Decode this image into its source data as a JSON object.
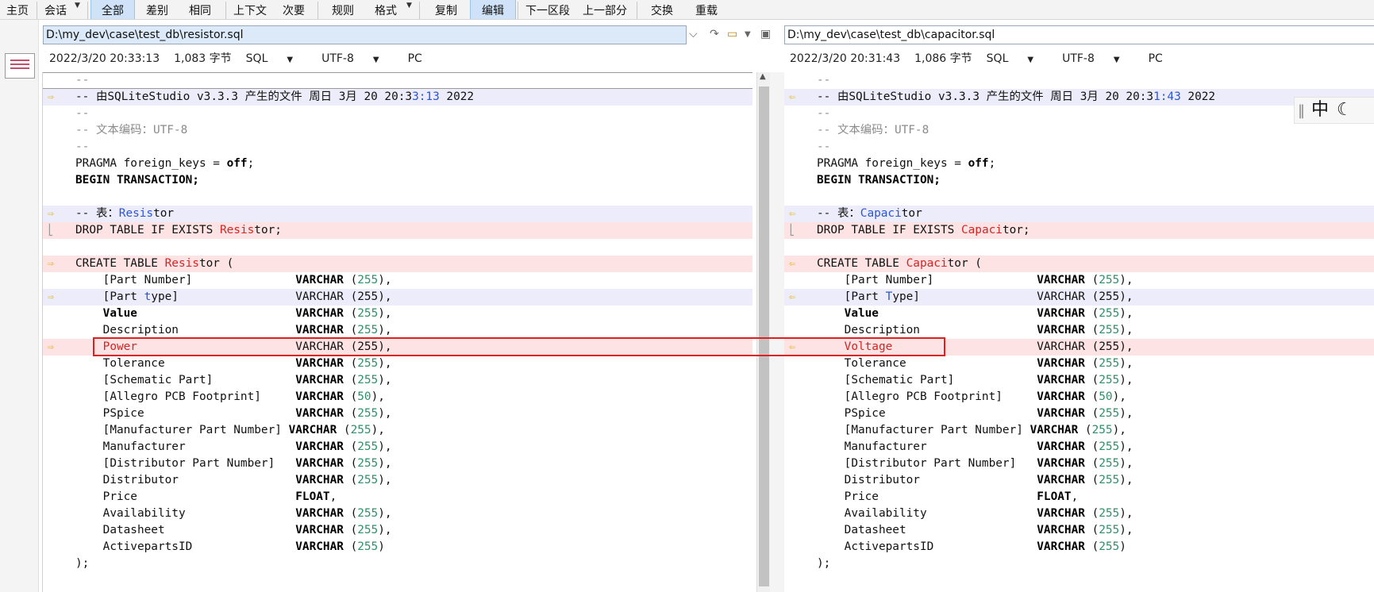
{
  "toolbar": {
    "items": [
      "主页",
      "会话",
      "全部",
      "差别",
      "相同",
      "上下文",
      "次要",
      "规则",
      "格式",
      "复制",
      "编辑",
      "下一区段",
      "上一部分",
      "交换",
      "重载"
    ]
  },
  "left": {
    "path": "D:\\my_dev\\case\\test_db\\resistor.sql",
    "info": {
      "datetime": "2022/3/20 20:33:13",
      "size": "1,083 字节",
      "format": "SQL",
      "encoding": "UTF-8",
      "eol": "PC"
    },
    "lines": [
      {
        "t": "--",
        "cls": "cmt",
        "bg": "cur"
      },
      {
        "parts": [
          [
            "-- 由SQLiteStudio v3.3.3 产生的文件 周日 3月 20 20:3",
            ""
          ],
          [
            "3:13",
            "chg"
          ],
          [
            " 2022",
            ""
          ]
        ],
        "bg": "mod",
        "mark": "arrow"
      },
      {
        "t": "--",
        "cls": "cmt"
      },
      {
        "t": "-- 文本编码：UTF-8",
        "cls": "cmt"
      },
      {
        "t": "--",
        "cls": "cmt"
      },
      {
        "parts": [
          [
            "PRAGMA foreign_keys = ",
            ""
          ],
          [
            "off",
            "kw"
          ],
          [
            ";",
            ""
          ]
        ]
      },
      {
        "parts": [
          [
            "BEGIN TRANSACTION;",
            "kw"
          ]
        ]
      },
      {
        "t": ""
      },
      {
        "parts": [
          [
            "-- 表：",
            ""
          ],
          [
            "Resis",
            "chg"
          ],
          [
            "tor",
            ""
          ]
        ],
        "bg": "mod",
        "mark": "arrow"
      },
      {
        "parts": [
          [
            "DROP TABLE IF EXISTS ",
            ""
          ],
          [
            "Resis",
            "del-t"
          ],
          [
            "tor;",
            ""
          ]
        ],
        "bg": "del",
        "mark": "bar"
      },
      {
        "t": ""
      },
      {
        "parts": [
          [
            "CREATE TABLE ",
            ""
          ],
          [
            "Resis",
            "del-t"
          ],
          [
            "tor (",
            ""
          ]
        ],
        "bg": "del",
        "mark": "arrow"
      },
      {
        "parts": [
          [
            "    [Part Number]               ",
            ""
          ],
          [
            "VARCHAR",
            "kw"
          ],
          [
            " (",
            ""
          ],
          [
            "255",
            "num"
          ],
          [
            "),",
            ""
          ]
        ]
      },
      {
        "parts": [
          [
            "    [Part ",
            ""
          ],
          [
            "t",
            "chg"
          ],
          [
            "ype]                 VARCHAR (255),",
            ""
          ]
        ],
        "bg": "mod",
        "mark": "arrow"
      },
      {
        "parts": [
          [
            "    ",
            ""
          ],
          [
            "Value",
            "kw"
          ],
          [
            "                       ",
            ""
          ],
          [
            "VARCHAR",
            "kw"
          ],
          [
            " (",
            ""
          ],
          [
            "255",
            "num"
          ],
          [
            "),",
            ""
          ]
        ]
      },
      {
        "parts": [
          [
            "    Description                 ",
            ""
          ],
          [
            "VARCHAR",
            "kw"
          ],
          [
            " (",
            ""
          ],
          [
            "255",
            "num"
          ],
          [
            "),",
            ""
          ]
        ]
      },
      {
        "parts": [
          [
            "    ",
            ""
          ],
          [
            "Power",
            "del-t"
          ],
          [
            "                       VARCHAR (255),",
            ""
          ]
        ],
        "bg": "del",
        "mark": "arrow"
      },
      {
        "parts": [
          [
            "    Tolerance                   ",
            ""
          ],
          [
            "VARCHAR",
            "kw"
          ],
          [
            " (",
            ""
          ],
          [
            "255",
            "num"
          ],
          [
            "),",
            ""
          ]
        ]
      },
      {
        "parts": [
          [
            "    [Schematic Part]            ",
            ""
          ],
          [
            "VARCHAR",
            "kw"
          ],
          [
            " (",
            ""
          ],
          [
            "255",
            "num"
          ],
          [
            "),",
            ""
          ]
        ]
      },
      {
        "parts": [
          [
            "    [Allegro PCB Footprint]     ",
            ""
          ],
          [
            "VARCHAR",
            "kw"
          ],
          [
            " (",
            ""
          ],
          [
            "50",
            "num"
          ],
          [
            "),",
            ""
          ]
        ]
      },
      {
        "parts": [
          [
            "    PSpice                      ",
            ""
          ],
          [
            "VARCHAR",
            "kw"
          ],
          [
            " (",
            ""
          ],
          [
            "255",
            "num"
          ],
          [
            "),",
            ""
          ]
        ]
      },
      {
        "parts": [
          [
            "    [Manufacturer Part Number] ",
            ""
          ],
          [
            "VARCHAR",
            "kw"
          ],
          [
            " (",
            ""
          ],
          [
            "255",
            "num"
          ],
          [
            "),",
            ""
          ]
        ]
      },
      {
        "parts": [
          [
            "    Manufacturer                ",
            ""
          ],
          [
            "VARCHAR",
            "kw"
          ],
          [
            " (",
            ""
          ],
          [
            "255",
            "num"
          ],
          [
            "),",
            ""
          ]
        ]
      },
      {
        "parts": [
          [
            "    [Distributor Part Number]   ",
            ""
          ],
          [
            "VARCHAR",
            "kw"
          ],
          [
            " (",
            ""
          ],
          [
            "255",
            "num"
          ],
          [
            "),",
            ""
          ]
        ]
      },
      {
        "parts": [
          [
            "    Distributor                 ",
            ""
          ],
          [
            "VARCHAR",
            "kw"
          ],
          [
            " (",
            ""
          ],
          [
            "255",
            "num"
          ],
          [
            "),",
            ""
          ]
        ]
      },
      {
        "parts": [
          [
            "    Price                       ",
            ""
          ],
          [
            "FLOAT",
            "kw"
          ],
          [
            ",",
            ""
          ]
        ]
      },
      {
        "parts": [
          [
            "    Availability                ",
            ""
          ],
          [
            "VARCHAR",
            "kw"
          ],
          [
            " (",
            ""
          ],
          [
            "255",
            "num"
          ],
          [
            "),",
            ""
          ]
        ]
      },
      {
        "parts": [
          [
            "    Datasheet                   ",
            ""
          ],
          [
            "VARCHAR",
            "kw"
          ],
          [
            " (",
            ""
          ],
          [
            "255",
            "num"
          ],
          [
            "),",
            ""
          ]
        ]
      },
      {
        "parts": [
          [
            "    ActivepartsID               ",
            ""
          ],
          [
            "VARCHAR",
            "kw"
          ],
          [
            " (",
            ""
          ],
          [
            "255",
            "num"
          ],
          [
            ")",
            ""
          ]
        ]
      },
      {
        "t": ");"
      }
    ]
  },
  "right": {
    "path": "D:\\my_dev\\case\\test_db\\capacitor.sql",
    "info": {
      "datetime": "2022/3/20 20:31:43",
      "size": "1,086 字节",
      "format": "SQL",
      "encoding": "UTF-8",
      "eol": "PC"
    },
    "lines": [
      {
        "t": "--",
        "cls": "cmt"
      },
      {
        "parts": [
          [
            "-- 由SQLiteStudio v3.3.3 产生的文件 周日 3月 20 20:3",
            ""
          ],
          [
            "1:43",
            "chg"
          ],
          [
            " 2022",
            ""
          ]
        ],
        "bg": "mod",
        "mark": "arrow"
      },
      {
        "t": "--",
        "cls": "cmt"
      },
      {
        "t": "-- 文本编码：UTF-8",
        "cls": "cmt"
      },
      {
        "t": "--",
        "cls": "cmt"
      },
      {
        "parts": [
          [
            "PRAGMA foreign_keys = ",
            ""
          ],
          [
            "off",
            "kw"
          ],
          [
            ";",
            ""
          ]
        ]
      },
      {
        "parts": [
          [
            "BEGIN TRANSACTION;",
            "kw"
          ]
        ]
      },
      {
        "t": ""
      },
      {
        "parts": [
          [
            "-- 表：",
            ""
          ],
          [
            "Capaci",
            "chg"
          ],
          [
            "tor",
            ""
          ]
        ],
        "bg": "mod",
        "mark": "arrow"
      },
      {
        "parts": [
          [
            "DROP TABLE IF EXISTS ",
            ""
          ],
          [
            "Capaci",
            "del-t"
          ],
          [
            "tor;",
            ""
          ]
        ],
        "bg": "del",
        "mark": "bar"
      },
      {
        "t": ""
      },
      {
        "parts": [
          [
            "CREATE TABLE ",
            ""
          ],
          [
            "Capaci",
            "del-t"
          ],
          [
            "tor (",
            ""
          ]
        ],
        "bg": "del",
        "mark": "arrow"
      },
      {
        "parts": [
          [
            "    [Part Number]               ",
            ""
          ],
          [
            "VARCHAR",
            "kw"
          ],
          [
            " (",
            ""
          ],
          [
            "255",
            "num"
          ],
          [
            "),",
            ""
          ]
        ]
      },
      {
        "parts": [
          [
            "    [Part ",
            ""
          ],
          [
            "T",
            "chg"
          ],
          [
            "ype]                 VARCHAR (255),",
            ""
          ]
        ],
        "bg": "mod",
        "mark": "arrow"
      },
      {
        "parts": [
          [
            "    ",
            ""
          ],
          [
            "Value",
            "kw"
          ],
          [
            "                       ",
            ""
          ],
          [
            "VARCHAR",
            "kw"
          ],
          [
            " (",
            ""
          ],
          [
            "255",
            "num"
          ],
          [
            "),",
            ""
          ]
        ]
      },
      {
        "parts": [
          [
            "    Description                 ",
            ""
          ],
          [
            "VARCHAR",
            "kw"
          ],
          [
            " (",
            ""
          ],
          [
            "255",
            "num"
          ],
          [
            "),",
            ""
          ]
        ]
      },
      {
        "parts": [
          [
            "    ",
            ""
          ],
          [
            "Voltage",
            "del-t"
          ],
          [
            "                     VARCHAR (255),",
            ""
          ]
        ],
        "bg": "del",
        "mark": "arrow"
      },
      {
        "parts": [
          [
            "    Tolerance                   ",
            ""
          ],
          [
            "VARCHAR",
            "kw"
          ],
          [
            " (",
            ""
          ],
          [
            "255",
            "num"
          ],
          [
            "),",
            ""
          ]
        ]
      },
      {
        "parts": [
          [
            "    [Schematic Part]            ",
            ""
          ],
          [
            "VARCHAR",
            "kw"
          ],
          [
            " (",
            ""
          ],
          [
            "255",
            "num"
          ],
          [
            "),",
            ""
          ]
        ]
      },
      {
        "parts": [
          [
            "    [Allegro PCB Footprint]     ",
            ""
          ],
          [
            "VARCHAR",
            "kw"
          ],
          [
            " (",
            ""
          ],
          [
            "50",
            "num"
          ],
          [
            "),",
            ""
          ]
        ]
      },
      {
        "parts": [
          [
            "    PSpice                      ",
            ""
          ],
          [
            "VARCHAR",
            "kw"
          ],
          [
            " (",
            ""
          ],
          [
            "255",
            "num"
          ],
          [
            "),",
            ""
          ]
        ]
      },
      {
        "parts": [
          [
            "    [Manufacturer Part Number] ",
            ""
          ],
          [
            "VARCHAR",
            "kw"
          ],
          [
            " (",
            ""
          ],
          [
            "255",
            "num"
          ],
          [
            "),",
            ""
          ]
        ]
      },
      {
        "parts": [
          [
            "    Manufacturer                ",
            ""
          ],
          [
            "VARCHAR",
            "kw"
          ],
          [
            " (",
            ""
          ],
          [
            "255",
            "num"
          ],
          [
            "),",
            ""
          ]
        ]
      },
      {
        "parts": [
          [
            "    [Distributor Part Number]   ",
            ""
          ],
          [
            "VARCHAR",
            "kw"
          ],
          [
            " (",
            ""
          ],
          [
            "255",
            "num"
          ],
          [
            "),",
            ""
          ]
        ]
      },
      {
        "parts": [
          [
            "    Distributor                 ",
            ""
          ],
          [
            "VARCHAR",
            "kw"
          ],
          [
            " (",
            ""
          ],
          [
            "255",
            "num"
          ],
          [
            "),",
            ""
          ]
        ]
      },
      {
        "parts": [
          [
            "    Price                       ",
            ""
          ],
          [
            "FLOAT",
            "kw"
          ],
          [
            ",",
            ""
          ]
        ]
      },
      {
        "parts": [
          [
            "    Availability                ",
            ""
          ],
          [
            "VARCHAR",
            "kw"
          ],
          [
            " (",
            ""
          ],
          [
            "255",
            "num"
          ],
          [
            "),",
            ""
          ]
        ]
      },
      {
        "parts": [
          [
            "    Datasheet                   ",
            ""
          ],
          [
            "VARCHAR",
            "kw"
          ],
          [
            " (",
            ""
          ],
          [
            "255",
            "num"
          ],
          [
            "),",
            ""
          ]
        ]
      },
      {
        "parts": [
          [
            "    ActivepartsID               ",
            ""
          ],
          [
            "VARCHAR",
            "kw"
          ],
          [
            " (",
            ""
          ],
          [
            "255",
            "num"
          ],
          [
            ")",
            ""
          ]
        ]
      },
      {
        "t": ");"
      }
    ]
  },
  "ime": {
    "label": "中"
  },
  "colors": {
    "changed": "#2a55d6",
    "removed": "#d42525",
    "number": "#2f8f6a",
    "modified_bg": "#ececfa",
    "removed_bg": "#fde3e3",
    "highlight": "#e02020"
  },
  "icons": {
    "diff_marker_left": "right-arrow-icon",
    "diff_marker_right": "left-arrow-icon",
    "ime_mode": "moon-icon"
  }
}
